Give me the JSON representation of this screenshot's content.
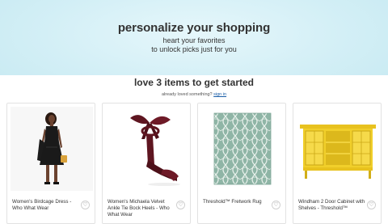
{
  "hero": {
    "title": "personalize your shopping",
    "line1": "heart your favorites",
    "line2": "to unlock picks just for you"
  },
  "onboarding": {
    "heading": "love 3 items to get started",
    "already_text": "already loved something?",
    "signin_link": "sign in"
  },
  "products": [
    {
      "name": "Women's Birdcage Dress - Who What Wear",
      "image": "black-dress-model",
      "heart_icon": "heart-outline-icon"
    },
    {
      "name": "Women's Michaela Velvet Ankle Tie Bock Heels - Who What Wear",
      "image": "burgundy-velvet-heels",
      "heart_icon": "heart-outline-icon"
    },
    {
      "name": "Threshold™ Fretwork Rug",
      "image": "sage-fretwork-rug",
      "heart_icon": "heart-outline-icon"
    },
    {
      "name": "Windham 2 Door Cabinet with Shelves - Threshold™",
      "image": "yellow-cabinet",
      "heart_icon": "heart-outline-icon"
    }
  ],
  "colors": {
    "hero_bg": "#d3eff6",
    "rug": "#8fb5a6",
    "cabinet": "#f1cf2a",
    "velvet": "#5e1520",
    "link": "#1a5ea8"
  }
}
